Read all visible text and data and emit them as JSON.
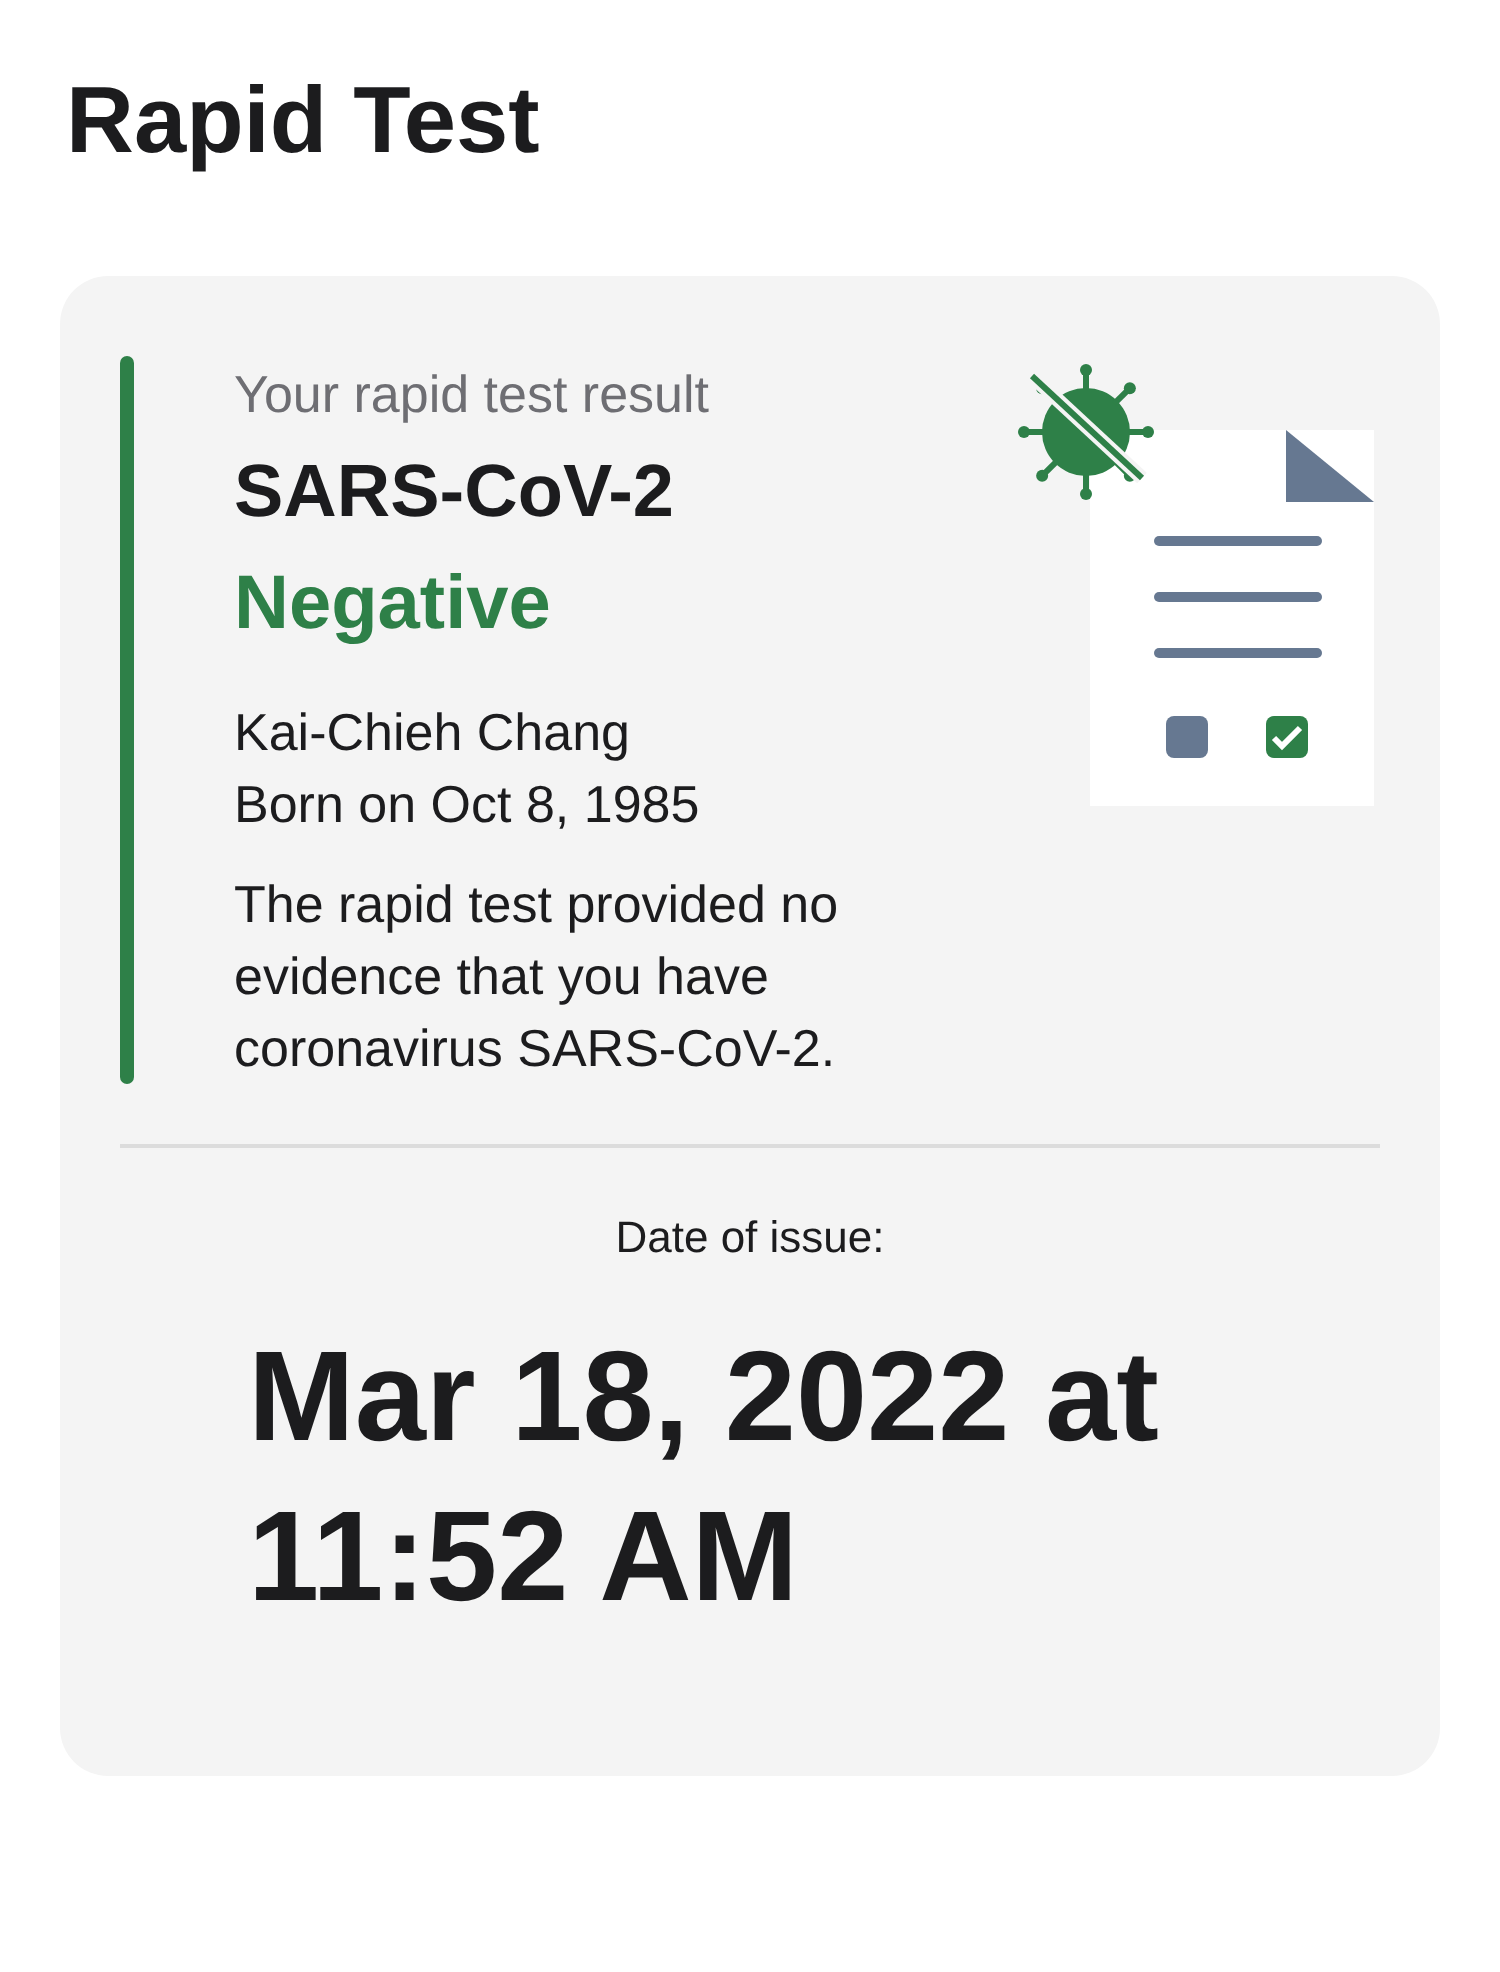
{
  "title": "Rapid Test",
  "result": {
    "caption": "Your rapid test result",
    "test_name": "SARS-CoV-2",
    "kind": "negative",
    "status_label": "Negative",
    "person_name": "Kai-Chieh Chang",
    "birth": "Born on Oct 8, 1985",
    "description": "The rapid test provided no evidence that you have coronavirus SARS-CoV-2."
  },
  "issue": {
    "label": "Date of issue:",
    "date": "Mar 18, 2022 at 11:52 AM"
  }
}
